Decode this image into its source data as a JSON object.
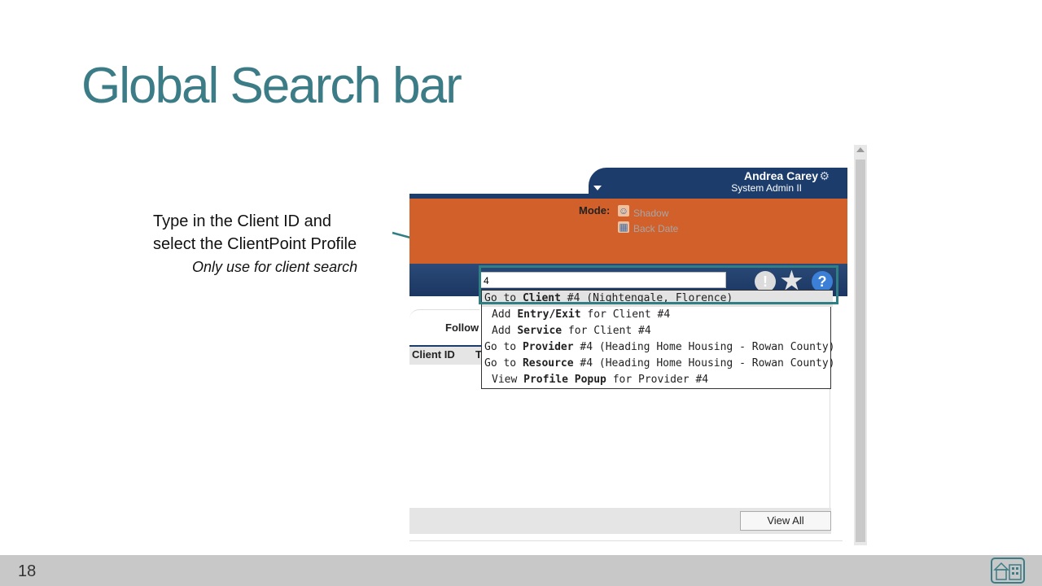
{
  "slide": {
    "title": "Global Search bar",
    "page_number": "18",
    "annotation": {
      "line1": "Type in the Client ID and",
      "line2": "select the ClientPoint Profile",
      "note": "Only use for client search"
    }
  },
  "app": {
    "user": {
      "name": "Andrea Carey",
      "role": "System Admin II"
    },
    "mode": {
      "label": "Mode:",
      "options": [
        "Shadow",
        "Back Date"
      ]
    },
    "search": {
      "value": "4"
    },
    "dropdown": [
      {
        "prefix": "Go to ",
        "bold": "Client",
        "suffix": " #4 (Nightengale, Florence)",
        "indent": false
      },
      {
        "prefix": "Add ",
        "bold": "Entry/Exit",
        "suffix": " for Client #4",
        "indent": true
      },
      {
        "prefix": "Add ",
        "bold": "Service",
        "suffix": " for Client #4",
        "indent": true
      },
      {
        "prefix": "Go to ",
        "bold": "Provider",
        "suffix": " #4 (Heading Home Housing - Rowan County)",
        "indent": false
      },
      {
        "prefix": "Go to ",
        "bold": "Resource",
        "suffix": " #4 (Heading Home Housing - Rowan County)",
        "indent": false
      },
      {
        "prefix": "View ",
        "bold": "Profile Popup",
        "suffix": " for Provider #4",
        "indent": true
      }
    ],
    "tab_label": "Follow",
    "table_headers": [
      "Client ID",
      "T"
    ],
    "view_all_label": "View All",
    "icons": [
      "alert-icon",
      "star-icon",
      "help-icon",
      "gear-icon"
    ]
  },
  "colors": {
    "title": "#3b7c86",
    "nav": "#1c3d6b",
    "orange": "#d2602a",
    "highlight": "#2f7f84"
  }
}
